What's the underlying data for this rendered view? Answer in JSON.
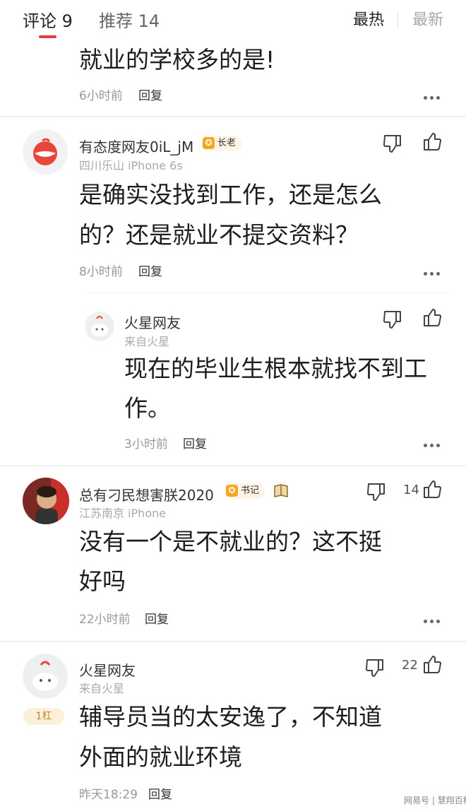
{
  "header": {
    "tab_comments": "评论 9",
    "tab_recommend": "推荐 14",
    "sort_hot": "最热",
    "sort_new": "最新"
  },
  "c0": {
    "text": "就业的学校多的是!",
    "time": "6小时前",
    "reply": "回复"
  },
  "c1": {
    "username": "有态度网友0iL_jM",
    "badge": "长老",
    "location": "四川乐山  iPhone 6s",
    "line1": "是确实没找到工作，还是怎么",
    "line2": "的？还是就业不提交资料？",
    "time": "8小时前",
    "reply": "回复"
  },
  "c1r": {
    "username": "火星网友",
    "location": "来自火星",
    "line1": "现在的毕业生根本就找不到工",
    "line2": "作。",
    "time": "3小时前",
    "reply": "回复"
  },
  "c2": {
    "username": "总有刁民想害朕2020",
    "badge": "书记",
    "location": "江苏南京  iPhone",
    "like_count": "14",
    "line1": "没有一个是不就业的？这不挺",
    "line2": "好吗",
    "time": "22小时前",
    "reply": "回复"
  },
  "c3": {
    "username": "火星网友",
    "location": "来自火星",
    "like_count": "22",
    "floor": "1杠",
    "line1": "辅导员当的太安逸了，不知道",
    "line2": "外面的就业环境",
    "time": "昨天18:29",
    "reply": "回复"
  },
  "watermark": "网易号 | 慧翔百科",
  "icons": {
    "like": "thumb-up-icon",
    "dislike": "thumb-down-icon",
    "more": "more-dots-icon",
    "badge": "medal-icon",
    "book": "book-icon"
  },
  "colors": {
    "accent": "#e4393c",
    "badge_bg": "#fff4e5",
    "badge_icon": "#f5a623",
    "floor_bg": "#fdf0db"
  }
}
